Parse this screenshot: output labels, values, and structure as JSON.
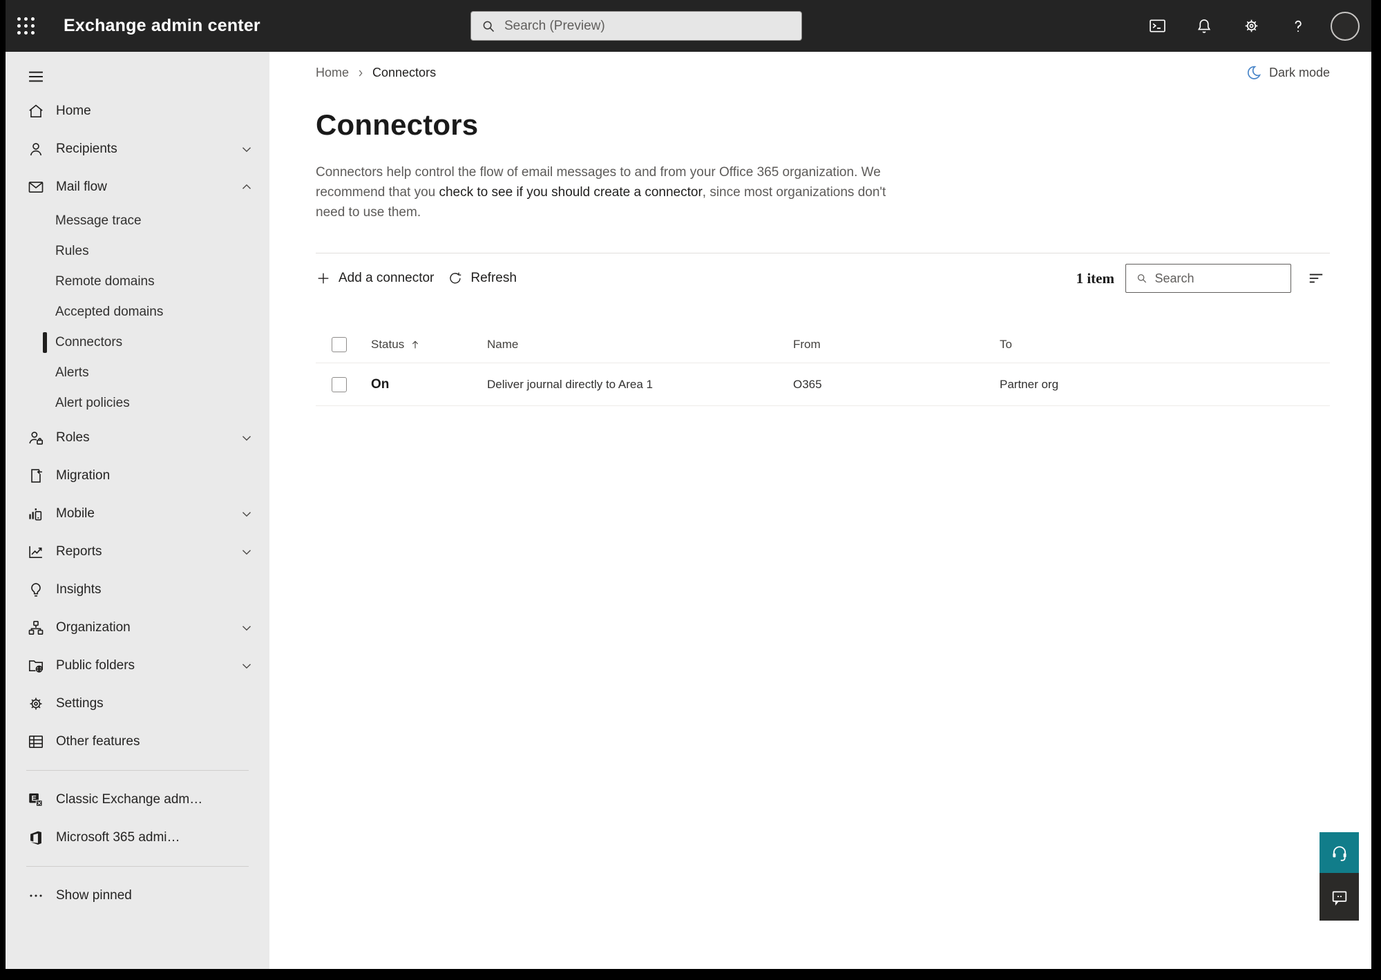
{
  "topbar": {
    "title": "Exchange admin center",
    "search": {
      "placeholder": "Search (Preview)"
    }
  },
  "sidebar": {
    "items": [
      {
        "label": "Home"
      },
      {
        "label": "Recipients"
      },
      {
        "label": "Mail flow"
      },
      {
        "label": "Message trace"
      },
      {
        "label": "Rules"
      },
      {
        "label": "Remote domains"
      },
      {
        "label": "Accepted domains"
      },
      {
        "label": "Connectors"
      },
      {
        "label": "Alerts"
      },
      {
        "label": "Alert policies"
      },
      {
        "label": "Roles"
      },
      {
        "label": "Migration"
      },
      {
        "label": "Mobile"
      },
      {
        "label": "Reports"
      },
      {
        "label": "Insights"
      },
      {
        "label": "Organization"
      },
      {
        "label": "Public folders"
      },
      {
        "label": "Settings"
      },
      {
        "label": "Other features"
      },
      {
        "label": "Classic Exchange adm…"
      },
      {
        "label": "Microsoft 365 admi…"
      },
      {
        "label": "Show pinned"
      }
    ]
  },
  "main": {
    "breadcrumb": {
      "home": "Home",
      "current": "Connectors"
    },
    "dark_mode_label": "Dark mode",
    "page_title": "Connectors",
    "description": {
      "before_link": "Connectors help control the flow of email messages to and from your Office 365 organization. We recommend that you ",
      "link": "check to see if you should create a connector",
      "after_link": ", since most organizations don't need to use them."
    },
    "toolbar": {
      "add_label": "Add a connector",
      "refresh_label": "Refresh",
      "item_count": "1 item",
      "search_placeholder": "Search"
    },
    "table": {
      "columns": {
        "status": "Status",
        "name": "Name",
        "from": "From",
        "to": "To"
      },
      "rows": [
        {
          "status": "On",
          "name": "Deliver journal directly to Area 1",
          "from": "O365",
          "to": "Partner org"
        }
      ]
    }
  },
  "colors": {
    "topbar_bg": "#242424",
    "sidebar_bg": "#eaeaea",
    "accent_teal": "#117d8a",
    "moon_blue": "#4a86c9"
  }
}
